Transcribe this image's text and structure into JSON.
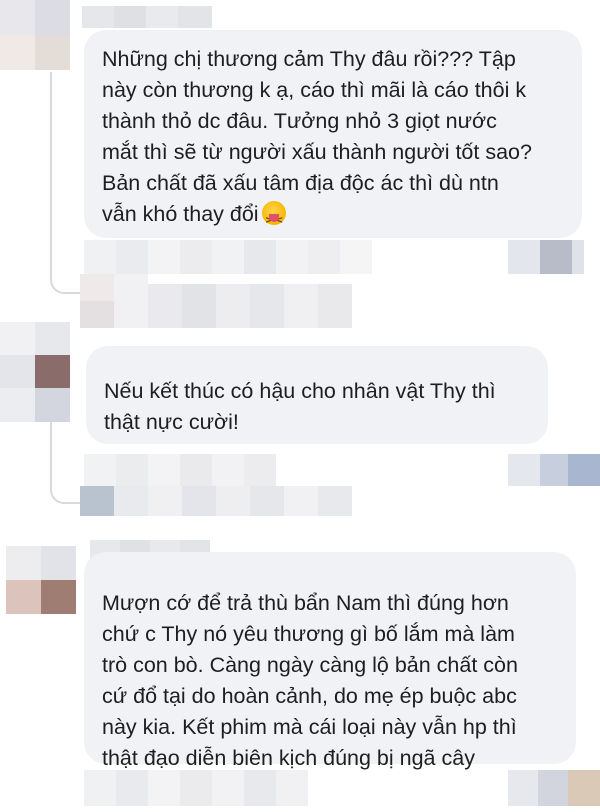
{
  "comments": [
    {
      "id": "comment-1",
      "lines": [
        "Những chị thương cảm Thy đâu rồi??? Tập",
        "này còn thương k ạ, cáo thì mãi là cáo thôi k",
        "thành thỏ dc đâu. Tưởng nhỏ 3 giọt nước",
        "mắt thì sẽ từ người xấu thành người tốt sao?",
        "Bản chất đã xấu tâm địa độc ác thì dù ntn",
        "vẫn khó thay đổi"
      ],
      "emoji": "squinting-face-with-tongue-icon"
    },
    {
      "id": "comment-2",
      "lines": [
        "Nếu kết thúc có hậu cho nhân vật Thy thì",
        "thật nực cười!"
      ]
    },
    {
      "id": "comment-3",
      "lines": [
        "Mượn cớ để trả thù bẩn Nam thì đúng hơn",
        "chứ c Thy nó yêu thương gì bố lắm mà làm",
        "trò con bò. Càng ngày càng lộ bản chất còn",
        "cứ đổ tại do hoàn cảnh, do mẹ ép buộc abc",
        "này kia. Kết phim mà cái loại này vẫn hp thì",
        "thật đạo diễn biên kịch đúng bị ngã cây"
      ]
    }
  ],
  "colors": {
    "bubble_bg": "#f0f2f5",
    "text": "#1c1e21",
    "thread_line": "#d6d9de",
    "pixelation_light": "#e9eaec",
    "pixelation_mid": "#c9ccd4",
    "pixelation_dark": "#8a6d6a"
  }
}
